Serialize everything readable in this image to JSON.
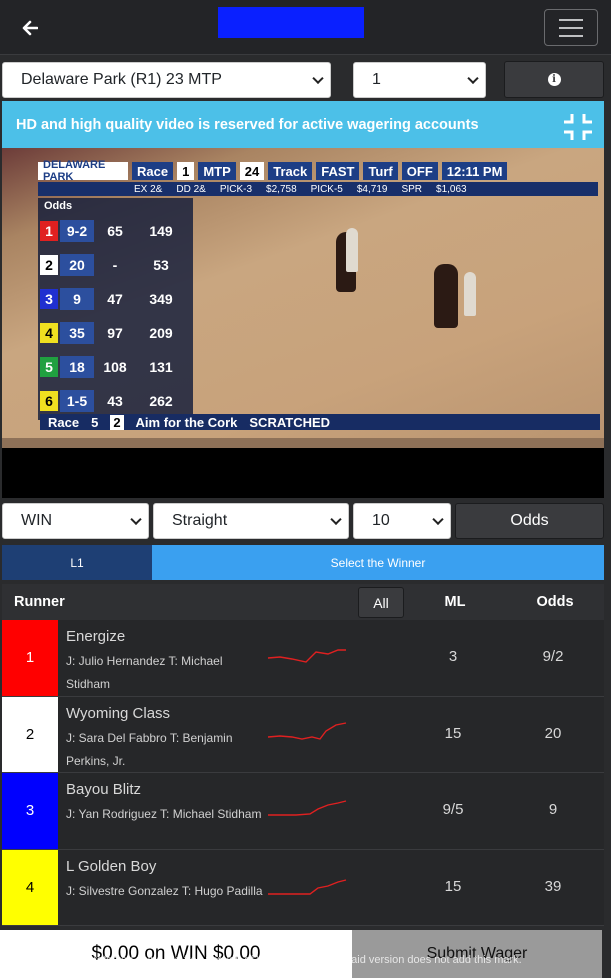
{
  "header": {
    "back_icon": "arrow-left-icon",
    "menu_icon": "hamburger-icon",
    "logo_color": "#0a20ff"
  },
  "selectors": {
    "race": "Delaware Park (R1) 23 MTP",
    "race_number": "1",
    "info_icon": "info-icon"
  },
  "notice": {
    "text": "HD and high quality video is reserved for active wagering accounts",
    "icon": "collapse-icon"
  },
  "video": {
    "scoreboard": {
      "track": "DELAWARE PARK",
      "race_label": "Race",
      "race_num": "1",
      "mtp_label": "MTP",
      "mtp": "24",
      "track_label": "Track",
      "track_cond": "FAST",
      "turf_label": "Turf",
      "turf_cond": "OFF",
      "time": "12:11 PM",
      "odds_label": "Odds",
      "ex_label": "EX 2&",
      "dd_label": "DD 2&",
      "pick3_label": "PICK-3",
      "pick3": "$2,758",
      "pick5_label": "PICK-5",
      "pick5": "$4,719",
      "spr_label": "SPR",
      "spr": "$1,063"
    },
    "board": [
      {
        "pp": "1",
        "odds": "9-2",
        "ex": "65",
        "dd": "149",
        "color": "#e02020"
      },
      {
        "pp": "2",
        "odds": "20",
        "ex": "-",
        "dd": "53",
        "color": "#ffffff"
      },
      {
        "pp": "3",
        "odds": "9",
        "ex": "47",
        "dd": "349",
        "color": "#2030d0"
      },
      {
        "pp": "4",
        "odds": "35",
        "ex": "97",
        "dd": "209",
        "color": "#f0e020"
      },
      {
        "pp": "5",
        "odds": "18",
        "ex": "108",
        "dd": "131",
        "color": "#20a040"
      },
      {
        "pp": "6",
        "odds": "1-5",
        "ex": "43",
        "dd": "262",
        "color": "#f0e020"
      }
    ],
    "ticker": {
      "label": "Race",
      "race": "5",
      "num": "2",
      "horse": "Aim for the Cork",
      "status": "SCRATCHED"
    }
  },
  "bet": {
    "type": "WIN",
    "style": "Straight",
    "amount": "10",
    "odds_button": "Odds"
  },
  "tabs": {
    "l1": "L1",
    "select_winner": "Select the Winner"
  },
  "table": {
    "headers": {
      "runner": "Runner",
      "all": "All",
      "ml": "ML",
      "odds": "Odds"
    },
    "runners": [
      {
        "num": "1",
        "name": "Energize",
        "jt": "J: Julio Hernandez T: Michael Stidham",
        "ml": "3",
        "odds": "9/2",
        "bg": "#ff0000",
        "fg": "#ffffff"
      },
      {
        "num": "2",
        "name": "Wyoming Class",
        "jt": "J: Sara Del Fabbro T: Benjamin Perkins, Jr.",
        "ml": "15",
        "odds": "20",
        "bg": "#ffffff",
        "fg": "#000000"
      },
      {
        "num": "3",
        "name": "Bayou Blitz",
        "jt": "J: Yan Rodriguez T: Michael Stidham",
        "ml": "9/5",
        "odds": "9",
        "bg": "#0000ff",
        "fg": "#ffffff"
      },
      {
        "num": "4",
        "name": "L Golden Boy",
        "jt": "J: Silvestre Gonzalez T: Hugo Padilla",
        "ml": "15",
        "odds": "39",
        "bg": "#ffff00",
        "fg": "#000000"
      }
    ]
  },
  "footer": {
    "summary": "$0.00 on WIN $0.00",
    "submit": "Submit Wager"
  },
  "watermark": "Protected using the free version of Watermarkly. The paid version does not add this mark.",
  "colors": {
    "accent": "#3aa0f0",
    "tab_dark": "#1e3f74",
    "notice": "#4cc0e8",
    "spark": "#e02020"
  }
}
